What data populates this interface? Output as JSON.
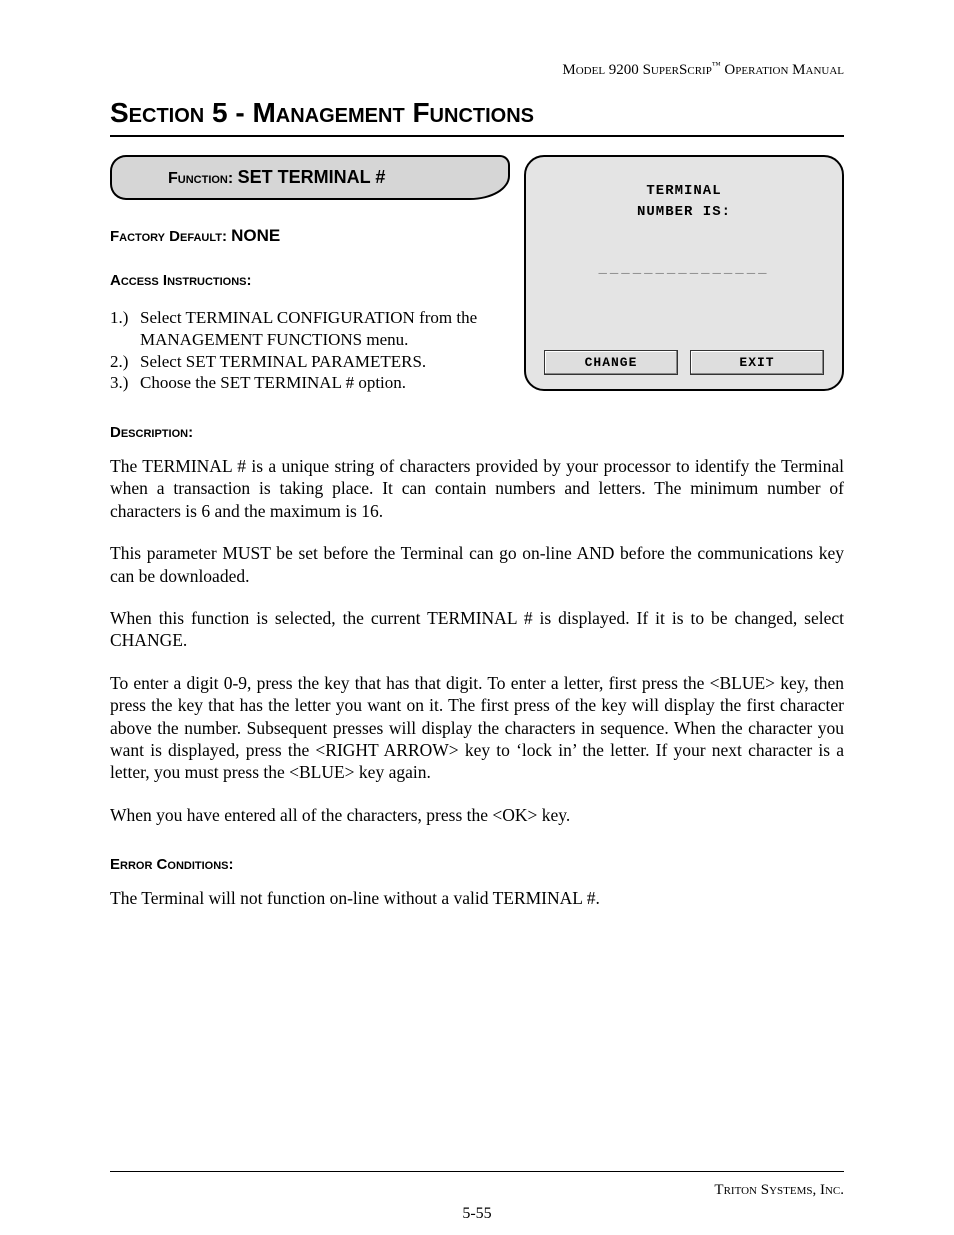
{
  "header": {
    "model": "Model 9200 ",
    "product": "SuperScrip",
    "tm": "™",
    "suffix": " Operation Manual"
  },
  "section_title": "Section 5 - Management Functions",
  "function_tab": {
    "label": "Function: ",
    "value": "SET TERMINAL #"
  },
  "factory_default": {
    "label": "Factory Default: ",
    "value": "NONE"
  },
  "access_instructions_label": "Access Instructions:",
  "steps": [
    {
      "num": "1.)",
      "text": "Select TERMINAL CONFIGURATION from the MANAGEMENT FUNCTIONS menu."
    },
    {
      "num": "2.)",
      "text": "Select SET TERMINAL PARAMETERS."
    },
    {
      "num": "3.)",
      "text": "Choose the SET TERMINAL # option."
    }
  ],
  "screen": {
    "line1": "TERMINAL",
    "line2": "NUMBER IS:",
    "placeholder": "_______________",
    "buttons": {
      "change": "CHANGE",
      "exit": "EXIT"
    }
  },
  "description_label": "Description:",
  "paragraphs": {
    "p1": "The TERMINAL # is a unique string of characters provided by your processor to identify the Terminal when a transaction is taking place.  It can contain numbers and letters. The minimum number of characters is 6 and the maximum is 16.",
    "p2": "This parameter MUST be set before the Terminal can go on-line AND before the communications key can be downloaded.",
    "p3": "When this function is selected, the current TERMINAL # is displayed.  If it is to be changed, select CHANGE.",
    "p4": "To enter a digit 0-9, press the key that has that digit.  To enter a letter, first press the <BLUE> key, then press the key that has the letter you want on it.  The first press of the key will display the first character above the number.  Subsequent presses will display the characters in sequence.  When the character you want is displayed, press the <RIGHT ARROW> key to ‘lock in’ the letter.  If your next character is a letter, you must press the <BLUE> key again.",
    "p5": "When you have entered all of the characters, press the <OK> key."
  },
  "error_conditions_label": "Error Conditions:",
  "error_text": "The Terminal will not function on-line without a valid TERMINAL #.",
  "footer": {
    "company": "Triton Systems, Inc.",
    "page": "5-55"
  }
}
